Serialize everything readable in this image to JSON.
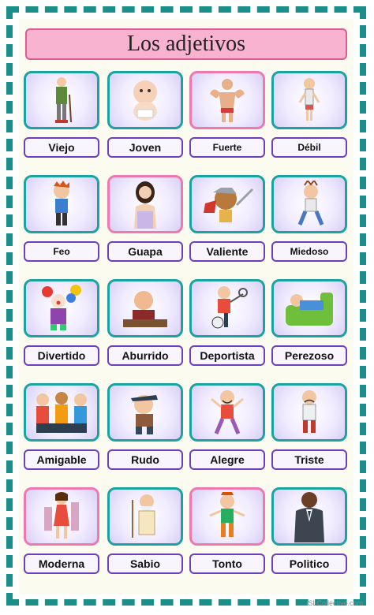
{
  "title": "Los adjetivos",
  "watermark": "iSLCollective.com",
  "cards": [
    {
      "label": "Viejo",
      "icon": "old-man-icon"
    },
    {
      "label": "Joven",
      "icon": "baby-icon"
    },
    {
      "label": "Fuerte",
      "icon": "strong-man-icon"
    },
    {
      "label": "Débil",
      "icon": "weak-man-icon"
    },
    {
      "label": "Feo",
      "icon": "ugly-boy-icon"
    },
    {
      "label": "Guapa",
      "icon": "pretty-woman-icon"
    },
    {
      "label": "Valiente",
      "icon": "brave-warrior-icon"
    },
    {
      "label": "Miedoso",
      "icon": "scared-man-icon"
    },
    {
      "label": "Divertido",
      "icon": "clown-icon"
    },
    {
      "label": "Aburrido",
      "icon": "bored-man-icon"
    },
    {
      "label": "Deportista",
      "icon": "athlete-icon"
    },
    {
      "label": "Perezoso",
      "icon": "lazy-man-icon"
    },
    {
      "label": "Amigable",
      "icon": "friends-icon"
    },
    {
      "label": "Rudo",
      "icon": "rude-boy-icon"
    },
    {
      "label": "Alegre",
      "icon": "happy-man-icon"
    },
    {
      "label": "Triste",
      "icon": "sad-man-icon"
    },
    {
      "label": "Moderna",
      "icon": "modern-woman-icon"
    },
    {
      "label": "Sabio",
      "icon": "wise-man-icon"
    },
    {
      "label": "Tonto",
      "icon": "silly-man-icon"
    },
    {
      "label": "Politico",
      "icon": "politician-icon"
    }
  ]
}
